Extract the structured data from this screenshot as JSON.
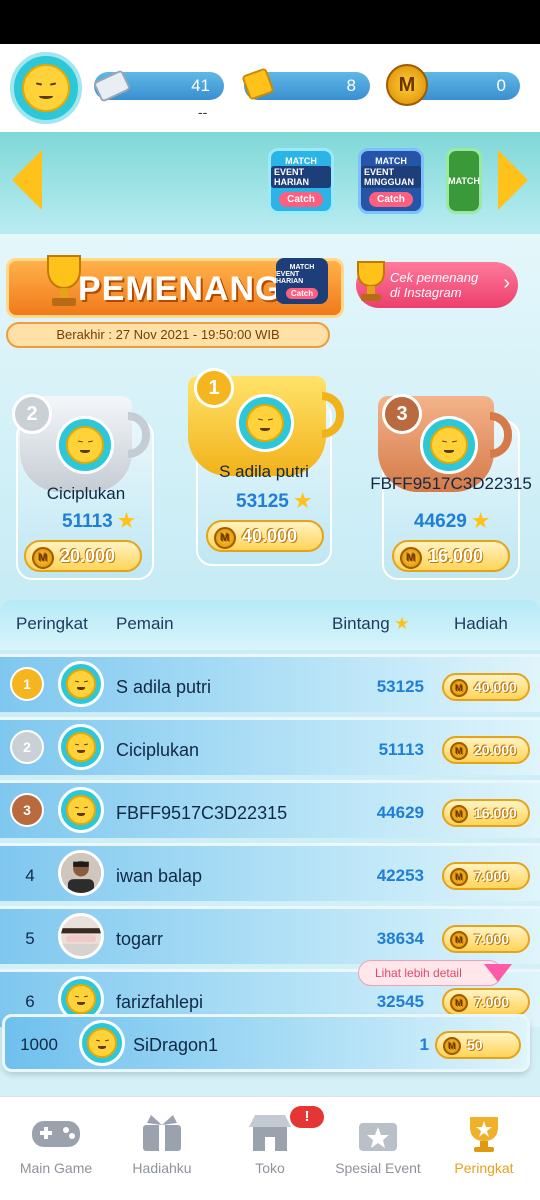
{
  "header": {
    "tickets": "41",
    "ticket_sub": "--",
    "gold_tickets": "8",
    "coins": "0"
  },
  "carousel": {
    "events": [
      {
        "badge": "MATCH",
        "title": "EVENT HARIAN",
        "button": "Catch"
      },
      {
        "badge": "MATCH",
        "title": "EVENT MINGGUAN",
        "button": "Catch"
      },
      {
        "badge": "MATCH",
        "title": "",
        "button": ""
      }
    ]
  },
  "banner": {
    "title": "PEMENANG",
    "badge_top": "MATCH",
    "badge_title": "EVENT HARIAN",
    "badge_button": "Catch",
    "ending": "Berakhir : 27 Nov 2021 - 19:50:00 WIB",
    "instagram_line1": "Cek pemenang",
    "instagram_line2": "di Instagram"
  },
  "podium": [
    {
      "rank": "1",
      "name": "S adila putri",
      "stars": "53125",
      "prize": "40.000"
    },
    {
      "rank": "2",
      "name": "Ciciplukan",
      "stars": "51113",
      "prize": "20.000"
    },
    {
      "rank": "3",
      "name": "FBFF9517C3D22315",
      "stars": "44629",
      "prize": "16.000"
    }
  ],
  "table": {
    "headers": {
      "rank": "Peringkat",
      "player": "Pemain",
      "stars": "Bintang",
      "prize": "Hadiah"
    },
    "rows": [
      {
        "rank": "1",
        "name": "S adila putri",
        "stars": "53125",
        "prize": "40.000"
      },
      {
        "rank": "2",
        "name": "Ciciplukan",
        "stars": "51113",
        "prize": "20.000"
      },
      {
        "rank": "3",
        "name": "FBFF9517C3D22315",
        "stars": "44629",
        "prize": "16.000"
      },
      {
        "rank": "4",
        "name": "iwan balap",
        "stars": "42253",
        "prize": "7.000"
      },
      {
        "rank": "5",
        "name": "togarr",
        "stars": "38634",
        "prize": "7.000"
      },
      {
        "rank": "6",
        "name": "farizfahlepi",
        "stars": "32545",
        "prize": "7.000"
      }
    ],
    "tooltip": "Lihat lebih detail"
  },
  "my_row": {
    "rank": "1000",
    "name": "SiDragon1",
    "stars": "1",
    "prize": "50"
  },
  "nav": {
    "items": [
      {
        "label": "Main Game",
        "icon": "gamepad-icon"
      },
      {
        "label": "Hadiahku",
        "icon": "gift-icon"
      },
      {
        "label": "Toko",
        "icon": "shop-icon"
      },
      {
        "label": "Spesial Event",
        "icon": "special-event-icon"
      },
      {
        "label": "Peringkat",
        "icon": "trophy-icon"
      }
    ],
    "alert": "!",
    "active": "Peringkat"
  },
  "colors": {
    "accent": "#f0b12a",
    "stars_blue": "#1f7fd6",
    "row_blue": "#7fc7ef"
  }
}
